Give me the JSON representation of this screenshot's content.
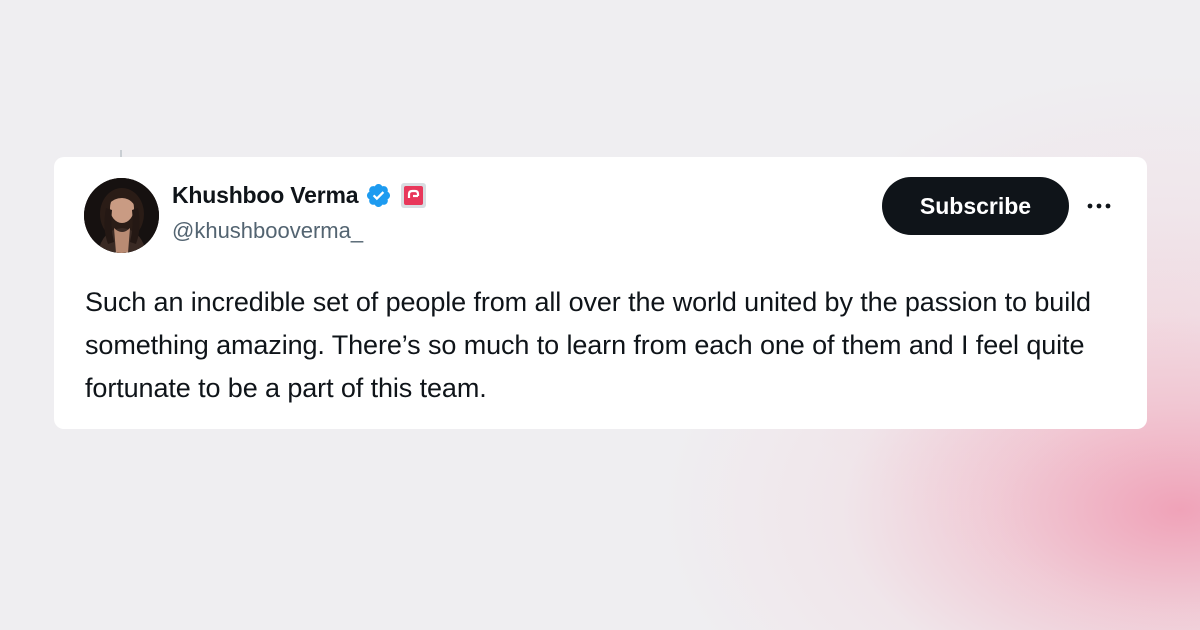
{
  "author": {
    "display_name": "Khushboo Verma",
    "handle": "@khushbooverma_",
    "verified": true,
    "avatar_icon": "avatar-photo",
    "affiliate_icon": "affiliate-badge-icon"
  },
  "actions": {
    "subscribe_label": "Subscribe",
    "more_icon": "more-options-icon"
  },
  "tweet": {
    "text": "Such an incredible set of people from all over the world united by the passion to build something amazing. There’s so much to learn from each one of them and I feel quite fortunate to be a part of this team."
  },
  "colors": {
    "background": "#efeef1",
    "card": "#ffffff",
    "verified_blue": "#1d9bf0",
    "affiliate_pink": "#e8375a",
    "button": "#0f1419",
    "handle_gray": "#536471",
    "accent_pink_glow": "#f096af"
  }
}
